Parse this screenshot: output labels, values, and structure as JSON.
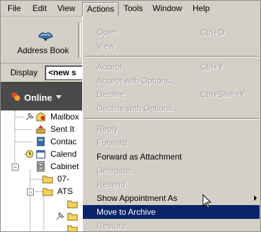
{
  "menubar": {
    "items": [
      {
        "label": "File"
      },
      {
        "label": "Edit"
      },
      {
        "label": "View"
      },
      {
        "label": "Actions"
      },
      {
        "label": "Tools"
      },
      {
        "label": "Window"
      },
      {
        "label": "Help"
      }
    ]
  },
  "toolbar": {
    "address_book_label": "Address Book"
  },
  "display": {
    "label": "Display",
    "value": "<new s"
  },
  "header": {
    "title": "Online"
  },
  "tree": {
    "items": [
      {
        "label": "Mailbox"
      },
      {
        "label": "Sent It"
      },
      {
        "label": "Contac"
      },
      {
        "label": "Calend"
      },
      {
        "label": "Cabinet"
      },
      {
        "label": "07-"
      },
      {
        "label": "ATS"
      }
    ]
  },
  "actions_menu": {
    "items": [
      {
        "label": "Open",
        "shortcut": "Ctrl+O"
      },
      {
        "label": "View",
        "shortcut": ""
      },
      {
        "label": "Accept",
        "shortcut": "Ctrl+Y"
      },
      {
        "label": "Accept with Options...",
        "shortcut": ""
      },
      {
        "label": "Decline",
        "shortcut": "Ctrl+Shift+Y"
      },
      {
        "label": "Decline with Options...",
        "shortcut": ""
      },
      {
        "label": "Reply...",
        "shortcut": ""
      },
      {
        "label": "Forward",
        "shortcut": ""
      },
      {
        "label": "Forward as Attachment",
        "shortcut": ""
      },
      {
        "label": "Delegate...",
        "shortcut": ""
      },
      {
        "label": "Resend",
        "shortcut": ""
      },
      {
        "label": "Show Appointment As",
        "shortcut": ""
      },
      {
        "label": "Move to Archive",
        "shortcut": ""
      },
      {
        "label": "Restore",
        "shortcut": ""
      }
    ]
  },
  "colors": {
    "menu_bg": "#d4d0c8",
    "highlight": "#0a246a",
    "header_bg": "#4a4a4a",
    "disabled_text": "#a2a2a2"
  }
}
